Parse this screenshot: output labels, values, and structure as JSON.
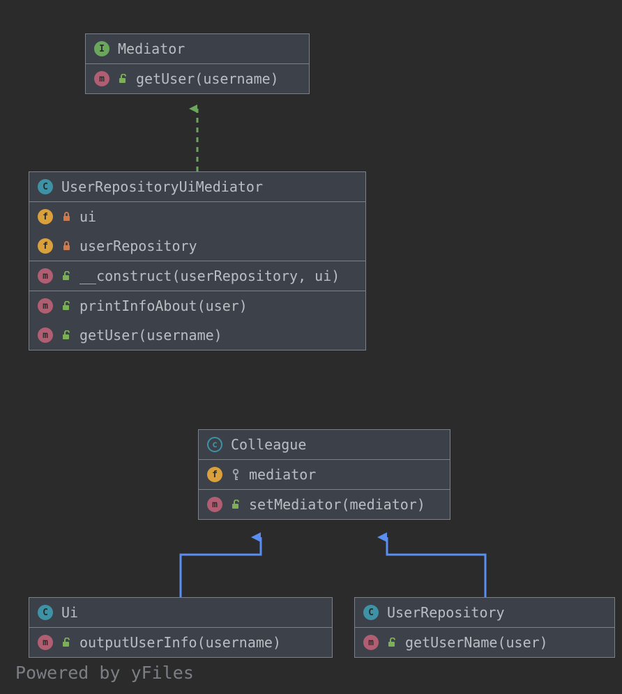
{
  "footer": "Powered by yFiles",
  "badges": {
    "I": "I",
    "C": "C",
    "c": "c",
    "f": "f",
    "m": "m"
  },
  "classes": {
    "mediator": {
      "name": "Mediator",
      "kind": "interface",
      "methods": [
        {
          "vis": "public",
          "sig": "getUser(username)"
        }
      ]
    },
    "urum": {
      "name": "UserRepositoryUiMediator",
      "kind": "class",
      "fields": [
        {
          "vis": "private",
          "name": "ui"
        },
        {
          "vis": "private",
          "name": "userRepository"
        }
      ],
      "methods": [
        {
          "vis": "public",
          "sig": "__construct(userRepository, ui)"
        },
        {
          "vis": "public",
          "sig": "printInfoAbout(user)"
        },
        {
          "vis": "public",
          "sig": "getUser(username)"
        }
      ]
    },
    "colleague": {
      "name": "Colleague",
      "kind": "abstract-class",
      "fields": [
        {
          "vis": "protected",
          "name": "mediator"
        }
      ],
      "methods": [
        {
          "vis": "public",
          "sig": "setMediator(mediator)"
        }
      ]
    },
    "ui": {
      "name": "Ui",
      "kind": "class",
      "methods": [
        {
          "vis": "public",
          "sig": "outputUserInfo(username)"
        }
      ]
    },
    "userRepository": {
      "name": "UserRepository",
      "kind": "class",
      "methods": [
        {
          "vis": "public",
          "sig": "getUserName(user)"
        }
      ]
    }
  }
}
